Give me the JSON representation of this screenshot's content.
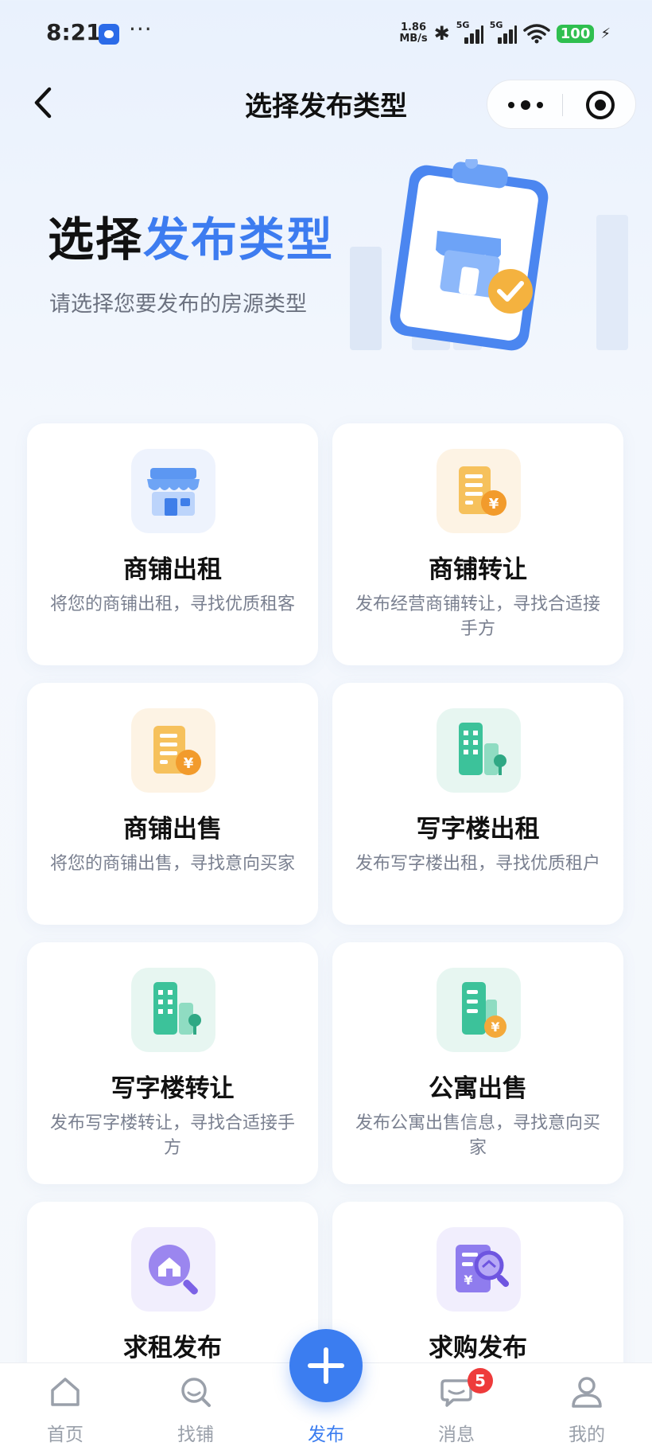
{
  "status_bar": {
    "time": "8:21",
    "net_speed_value": "1.86",
    "net_speed_unit": "MB/s",
    "signal_1": "5G",
    "signal_2": "5G",
    "battery": "100"
  },
  "nav": {
    "title": "选择发布类型"
  },
  "hero": {
    "title_plain": "选择",
    "title_accent": "发布类型",
    "subtitle": "请选择您要发布的房源类型"
  },
  "cards": [
    {
      "title": "商铺出租",
      "desc": "将您的商铺出租，寻找优质租客",
      "icon": "shop-icon"
    },
    {
      "title": "商铺转让",
      "desc": "发布经营商铺转让，寻找合适接手方",
      "icon": "building-yuan-icon"
    },
    {
      "title": "商铺出售",
      "desc": "将您的商铺出售，寻找意向买家",
      "icon": "building-yuan-icon"
    },
    {
      "title": "写字楼出租",
      "desc": "发布写字楼出租，寻找优质租户",
      "icon": "office-building-icon"
    },
    {
      "title": "写字楼转让",
      "desc": "发布写字楼转让，寻找合适接手方",
      "icon": "office-building-icon"
    },
    {
      "title": "公寓出售",
      "desc": "发布公寓出售信息，寻找意向买家",
      "icon": "apartment-yuan-icon"
    },
    {
      "title": "求租发布",
      "desc": "",
      "icon": "house-search-icon"
    },
    {
      "title": "求购发布",
      "desc": "",
      "icon": "document-search-icon"
    }
  ],
  "tabbar": {
    "items": [
      {
        "label": "首页",
        "icon": "home-icon"
      },
      {
        "label": "找铺",
        "icon": "search-icon"
      },
      {
        "label": "发布",
        "icon": "plus-icon"
      },
      {
        "label": "消息",
        "icon": "chat-icon",
        "badge": "5"
      },
      {
        "label": "我的",
        "icon": "user-icon"
      }
    ],
    "active": "发布"
  },
  "colors": {
    "accent": "#3b7df0",
    "badge": "#ee3b3b",
    "battery": "#2fbf4f"
  }
}
